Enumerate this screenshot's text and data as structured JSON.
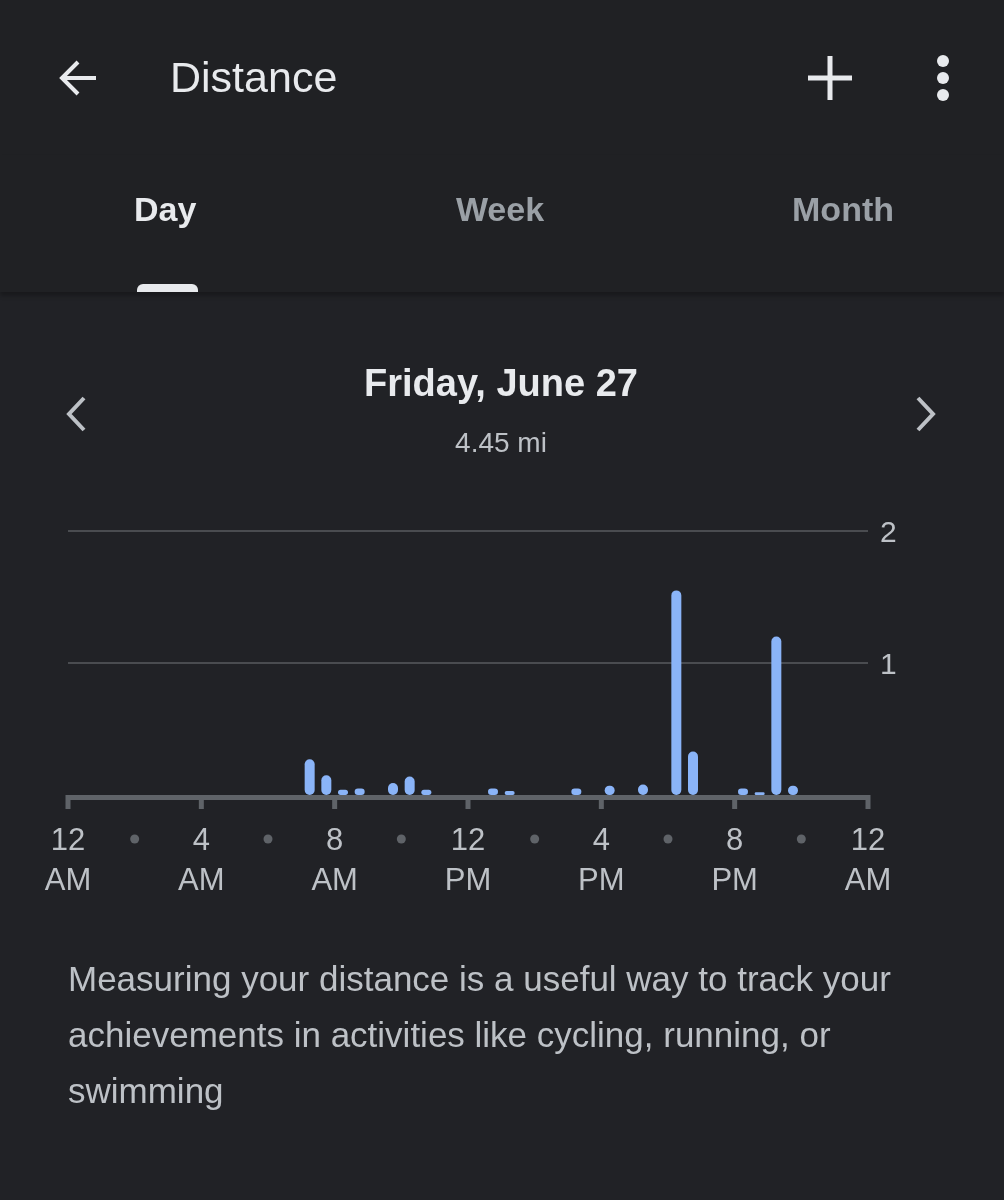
{
  "app_bar": {
    "title": "Distance"
  },
  "tabs": [
    {
      "label": "Day",
      "selected": true
    },
    {
      "label": "Week",
      "selected": false
    },
    {
      "label": "Month",
      "selected": false
    }
  ],
  "period": {
    "title": "Friday, June 27",
    "total": "4.45 mi"
  },
  "chart": {
    "chart_data": {
      "type": "bar",
      "categories": [
        "12 AM",
        null,
        null,
        null,
        null,
        null,
        null,
        null,
        null,
        null,
        null,
        null,
        null,
        null,
        null,
        null,
        "4 AM",
        null,
        null,
        null,
        null,
        null,
        null,
        null,
        null,
        null,
        null,
        null,
        null,
        null,
        null,
        null,
        "8 AM",
        null,
        null,
        null,
        null,
        null,
        null,
        null,
        null,
        null,
        null,
        null,
        null,
        null,
        null,
        null,
        "12 PM",
        null,
        null,
        null,
        null,
        null,
        null,
        null,
        null,
        null,
        null,
        null,
        null,
        null,
        null,
        null,
        "4 PM",
        null,
        null,
        null,
        null,
        null,
        null,
        null,
        null,
        null,
        null,
        null,
        null,
        null,
        null,
        null,
        "8 PM",
        null,
        null,
        null,
        null,
        null,
        null,
        null,
        null,
        null,
        null,
        null,
        null,
        null,
        null,
        null,
        "12 AM"
      ],
      "series": [
        {
          "color": "#8ab4f8",
          "values": [
            null,
            null,
            null,
            null,
            null,
            null,
            null,
            null,
            null,
            null,
            null,
            null,
            null,
            null,
            null,
            null,
            null,
            null,
            null,
            null,
            null,
            null,
            null,
            null,
            null,
            null,
            null,
            null,
            null,
            0.27,
            null,
            0.15,
            null,
            0.04,
            null,
            0.05,
            null,
            null,
            null,
            0.09,
            null,
            0.14,
            null,
            0.04,
            null,
            null,
            null,
            null,
            null,
            null,
            null,
            0.05,
            null,
            0.03,
            null,
            null,
            null,
            null,
            null,
            null,
            null,
            0.05,
            null,
            null,
            null,
            0.07,
            null,
            null,
            null,
            0.08,
            null,
            null,
            null,
            1.55,
            null,
            0.33,
            null,
            null,
            null,
            null,
            null,
            0.05,
            null,
            0.02,
            null,
            1.2,
            null,
            0.07,
            null,
            null,
            null,
            null,
            null,
            null,
            null,
            null,
            null
          ]
        }
      ],
      "ylim": [
        0,
        2
      ],
      "yticks": [
        1,
        2
      ]
    }
  },
  "description": "Measuring your distance is a useful way to track your achievements in activities like cycling, running, or swimming"
}
